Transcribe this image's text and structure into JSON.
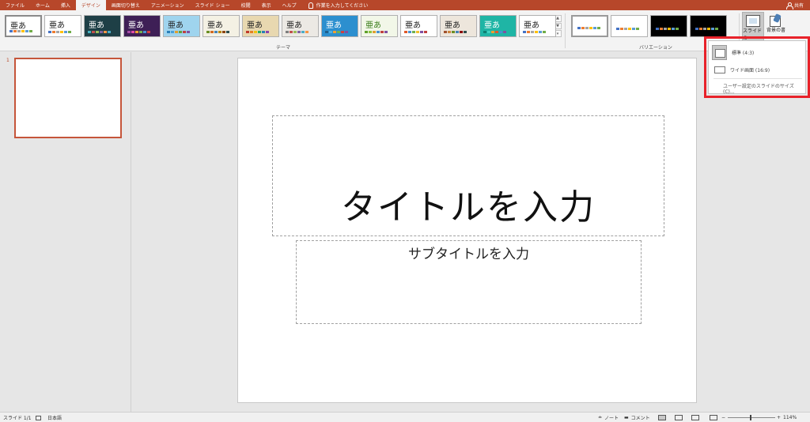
{
  "tabs": [
    "ファイル",
    "ホーム",
    "挿入",
    "デザイン",
    "画面切り替え",
    "アニメーション",
    "スライド ショー",
    "校閲",
    "表示",
    "ヘルプ"
  ],
  "active_tab": "デザイン",
  "tell_me": "作業を入力してください",
  "share": "共有",
  "ribbon": {
    "theme_glyph": "亜あ",
    "themes_label": "テーマ",
    "variants_label": "バリエーション",
    "slide_size_label": "スライドの",
    "format_background_label": "背景の書"
  },
  "themes": [
    {
      "bg": "#ffffff",
      "fg": "#222222",
      "sw": [
        "#4472c4",
        "#ed7d31",
        "#a5a5a5",
        "#ffc000",
        "#5b9bd5",
        "#70ad47"
      ]
    },
    {
      "bg": "#ffffff",
      "fg": "#222222",
      "sw": [
        "#4472c4",
        "#ed7d31",
        "#a5a5a5",
        "#ffc000",
        "#5b9bd5",
        "#70ad47"
      ]
    },
    {
      "bg": "#1e3f46",
      "fg": "#ffffff",
      "sw": [
        "#46b2c1",
        "#c0504d",
        "#9bbb59",
        "#8064a2",
        "#f79646",
        "#4bacc6"
      ]
    },
    {
      "bg": "#3e1f56",
      "fg": "#ffffff",
      "sw": [
        "#a64ca6",
        "#e04ca6",
        "#f0a030",
        "#70b050",
        "#4a90d0",
        "#d04040"
      ]
    },
    {
      "bg": "#9fd4ee",
      "fg": "#222222",
      "sw": [
        "#2a7fb8",
        "#4aa0d8",
        "#e0a030",
        "#60a040",
        "#c04040",
        "#8050a0"
      ]
    },
    {
      "bg": "#f4f1e4",
      "fg": "#222222",
      "sw": [
        "#6b8e23",
        "#d2691e",
        "#4682b4",
        "#b8860b",
        "#8b4513",
        "#2f4f4f"
      ]
    },
    {
      "bg": "#e8d8b0",
      "fg": "#222222",
      "sw": [
        "#c0392b",
        "#e67e22",
        "#f1c40f",
        "#27ae60",
        "#2980b9",
        "#8e44ad"
      ]
    },
    {
      "bg": "#ece9e4",
      "fg": "#222222",
      "sw": [
        "#7f7f7f",
        "#c0504d",
        "#9bbb59",
        "#8064a2",
        "#4bacc6",
        "#f79646"
      ]
    },
    {
      "bg": "#2c8fcf",
      "fg": "#ffffff",
      "sw": [
        "#1f5f8b",
        "#4fb0e0",
        "#f0a030",
        "#70b050",
        "#d04040",
        "#8050a0"
      ]
    },
    {
      "bg": "#f2f7e8",
      "fg": "#3a7d1a",
      "sw": [
        "#5fa12a",
        "#8cc63f",
        "#e0a030",
        "#4a90d0",
        "#c04040",
        "#8050a0"
      ]
    },
    {
      "bg": "#ffffff",
      "fg": "#222222",
      "sw": [
        "#e05a2a",
        "#4a90d0",
        "#70b050",
        "#f0c030",
        "#8050a0",
        "#c04040"
      ]
    },
    {
      "bg": "#ede6dc",
      "fg": "#222222",
      "sw": [
        "#a0522d",
        "#cd853f",
        "#6b8e23",
        "#4682b4",
        "#8b0000",
        "#2f4f4f"
      ]
    },
    {
      "bg": "#1fb5a5",
      "fg": "#ffffff",
      "sw": [
        "#0f7f73",
        "#3fd0c0",
        "#f0a030",
        "#e05a2a",
        "#4a90d0",
        "#8050a0"
      ]
    },
    {
      "bg": "#ffffff",
      "fg": "#222222",
      "sw": [
        "#4472c4",
        "#ed7d31",
        "#a5a5a5",
        "#ffc000",
        "#5b9bd5",
        "#70ad47"
      ]
    }
  ],
  "variants": [
    {
      "bg": "#ffffff",
      "sw": [
        "#4472c4",
        "#ed7d31",
        "#a5a5a5",
        "#ffc000",
        "#5b9bd5",
        "#70ad47"
      ]
    },
    {
      "bg": "#ffffff",
      "sw": [
        "#4472c4",
        "#ed7d31",
        "#a5a5a5",
        "#ffc000",
        "#5b9bd5",
        "#70ad47"
      ]
    },
    {
      "bg": "#000000",
      "sw": [
        "#4472c4",
        "#ed7d31",
        "#a5a5a5",
        "#ffc000",
        "#5b9bd5",
        "#70ad47"
      ]
    },
    {
      "bg": "#000000",
      "sw": [
        "#4472c4",
        "#ed7d31",
        "#a5a5a5",
        "#ffc000",
        "#5b9bd5",
        "#70ad47"
      ]
    }
  ],
  "slide_panel": {
    "number": "1"
  },
  "slide": {
    "title": "タイトルを入力",
    "subtitle": "サブタイトルを入力"
  },
  "slide_size_menu": {
    "standard": "標準 (4:3)",
    "widescreen": "ワイド画面 (16:9)",
    "custom": "ユーザー設定のスライドのサイズ(C)..."
  },
  "status": {
    "slide_count": "スライド 1/1",
    "language": "日本語",
    "notes": "ノート",
    "comments": "コメント",
    "zoom": "114%"
  }
}
